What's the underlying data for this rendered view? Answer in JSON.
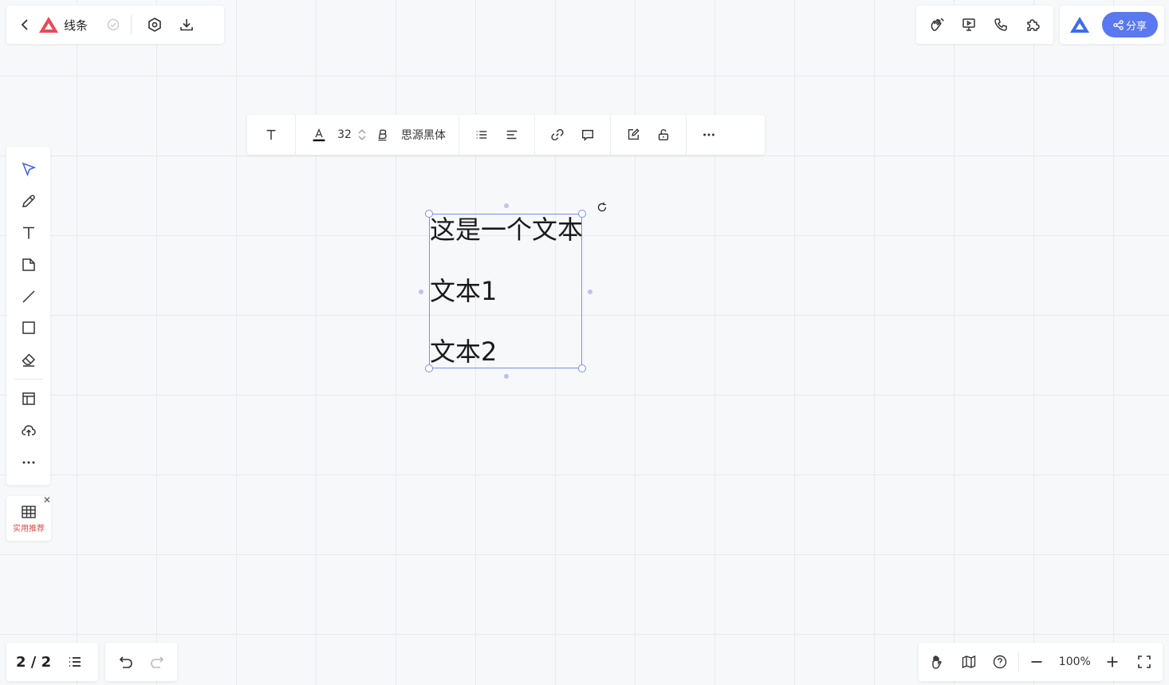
{
  "app": {
    "title": "线条",
    "brand_color": "#e94a58",
    "accent_color": "#5a78f0"
  },
  "top_right": {
    "share_label": "分享"
  },
  "format_toolbar": {
    "font_size": "32",
    "font_family": "思源黑体"
  },
  "canvas": {
    "text_lines": [
      "这是一个文本",
      "文本1",
      "文本2"
    ]
  },
  "recommend": {
    "label": "实用推荐"
  },
  "bottom": {
    "pages": "2 / 2",
    "zoom": "100%"
  }
}
